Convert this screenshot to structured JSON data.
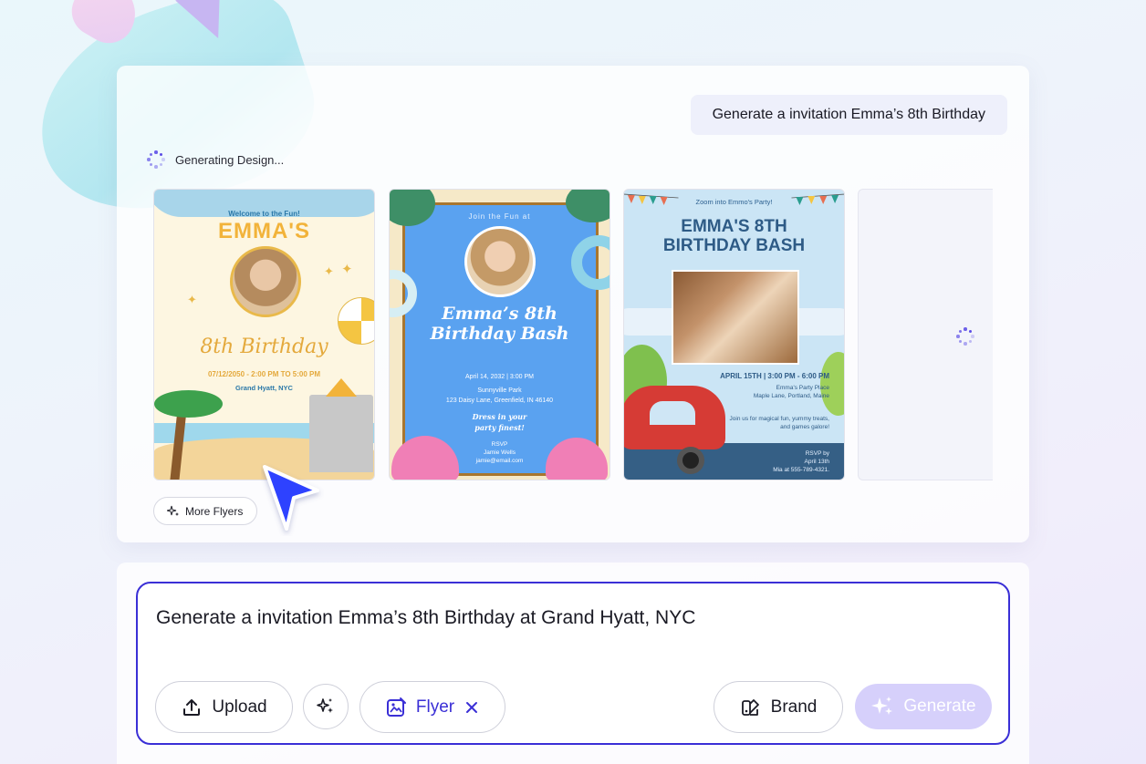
{
  "prompt_bubble": "Generate a invitation Emma’s 8th Birthday",
  "status": "Generating Design...",
  "designs": [
    {
      "welcome": "Welcome to the Fun!",
      "name": "EMMA'S",
      "script": "8th Birthday",
      "date": "07/12/2050 - 2:00 PM TO 5:00 PM",
      "place": "Grand Hyatt, NYC"
    },
    {
      "join": "Join the Fun at",
      "title_line1": "Emma’s 8th",
      "title_line2": "Birthday Bash",
      "date": "April 14, 2032 | 3:00 PM",
      "park": "Sunnyville Park",
      "address": "123 Daisy Lane, Greenfield, IN 46140",
      "dress1": "Dress in your",
      "dress2": "party finest!",
      "rsvp": "RSVP",
      "rsvp_name": "Jamie Wells",
      "rsvp_email": "jamie@email.com"
    },
    {
      "zoom": "Zoom into Emmo's Party!",
      "title_line1": "EMMA'S 8TH",
      "title_line2": "BIRTHDAY BASH",
      "date": "APRIL 15TH | 3:00 PM - 6:00 PM",
      "place1": "Emma's Party Place",
      "place2": "Maple Lane, Portland, Maine",
      "join1": "Join us for magical fun, yummy treats,",
      "join2": "and games galore!",
      "rsvp1": "RSVP by",
      "rsvp2": "April 13th",
      "rsvp3": "Mia at 555-789-4321."
    }
  ],
  "more_button": "More Flyers",
  "input": {
    "value": "Generate a invitation Emma’s 8th Birthday at Grand Hyatt, NYC"
  },
  "buttons": {
    "upload": "Upload",
    "flyer": "Flyer",
    "brand": "Brand",
    "generate": "Generate"
  },
  "colors": {
    "accent": "#3a2fd6",
    "generate_bg": "#d6d0fb"
  }
}
